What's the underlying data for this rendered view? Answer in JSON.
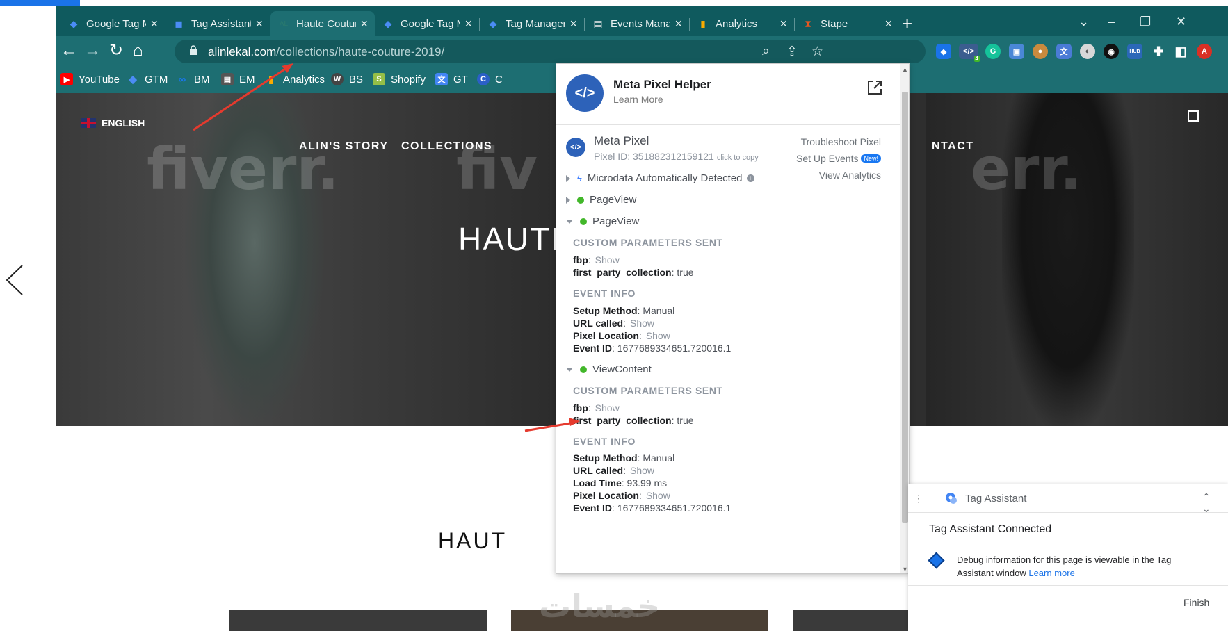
{
  "tabs": [
    {
      "label": "Google Tag M",
      "icon": "diamond-icon",
      "color": "#4b8cf5"
    },
    {
      "label": "Tag Assistant",
      "icon": "tag-icon",
      "color": "#4b8cf5"
    },
    {
      "label": "Haute Coutur",
      "icon": "site-favicon",
      "color": "#2a7a6e",
      "favicon": "AL"
    },
    {
      "label": "Google Tag M",
      "icon": "diamond-icon",
      "color": "#4b8cf5"
    },
    {
      "label": "Tag Manager",
      "icon": "diamond-icon",
      "color": "#4b8cf5"
    },
    {
      "label": "Events Mana",
      "icon": "events-manager-icon",
      "color": "#e8e8e8"
    },
    {
      "label": "Analytics",
      "icon": "analytics-icon",
      "color": "#f9ab00"
    },
    {
      "label": "Stape",
      "icon": "stape-icon",
      "color": "#e8561f"
    }
  ],
  "address": {
    "domain": "alinlekal.com",
    "path": "/collections/haute-couture-2019/"
  },
  "extensions": {
    "pixel_badge": "4",
    "avatar_letter": "A"
  },
  "bookmarks": [
    {
      "label": "YouTube",
      "icon": "youtube-icon",
      "color": "#ff0000",
      "glyph": "▶"
    },
    {
      "label": "GTM",
      "icon": "gtm-icon",
      "color": "#4b8cf5",
      "glyph": "◆"
    },
    {
      "label": "BM",
      "icon": "meta-icon",
      "color": "#1877f2",
      "glyph": "∞"
    },
    {
      "label": "EM",
      "icon": "events-manager-icon",
      "color": "#555555",
      "glyph": "▤"
    },
    {
      "label": "Analytics",
      "icon": "analytics-icon",
      "color": "#f9ab00",
      "glyph": "▮"
    },
    {
      "label": "BS",
      "icon": "wordpress-icon",
      "color": "#444444",
      "glyph": "W"
    },
    {
      "label": "Shopify",
      "icon": "shopify-icon",
      "color": "#95bf47",
      "glyph": "S"
    },
    {
      "label": "GT",
      "icon": "google-translate-icon",
      "color": "#4285f4",
      "glyph": "文"
    },
    {
      "label": "C",
      "icon": "c-icon",
      "color": "#2b5fc7",
      "glyph": "C"
    }
  ],
  "hero": {
    "language": "ENGLISH",
    "nav": [
      "ALIN'S STORY",
      "COLLECTIONS",
      "NTACT"
    ],
    "title": "HAUTE",
    "watermarks": [
      "fiverr.",
      "fiv",
      "err."
    ]
  },
  "page": {
    "heading": "HAUT"
  },
  "pixel_helper": {
    "title": "Meta Pixel Helper",
    "subtitle": "Learn More",
    "pixel_name": "Meta Pixel",
    "pixel_id": "Pixel ID: 351882312159121",
    "copy_hint": "click to copy",
    "troubleshoot": "Troubleshoot Pixel",
    "setup_events": "Set Up Events",
    "new_badge": "New!",
    "view_analytics": "View Analytics",
    "microdata": "Microdata Automatically Detected",
    "events": [
      {
        "name": "PageView",
        "expanded": false
      },
      {
        "name": "PageView",
        "expanded": true,
        "params_header": "CUSTOM PARAMETERS SENT",
        "params": [
          {
            "key": "fbp",
            "value": "Show",
            "muted": true
          },
          {
            "key": "first_party_collection",
            "value": "true",
            "muted": false
          }
        ],
        "info_header": "EVENT INFO",
        "info": [
          {
            "key": "Setup Method",
            "value": "Manual",
            "muted": false
          },
          {
            "key": "URL called",
            "value": "Show",
            "muted": true
          },
          {
            "key": "Pixel Location",
            "value": "Show",
            "muted": true
          },
          {
            "key": "Event ID",
            "value": "1677689334651.720016.1",
            "muted": false
          }
        ]
      },
      {
        "name": "ViewContent",
        "expanded": true,
        "params_header": "CUSTOM PARAMETERS SENT",
        "params": [
          {
            "key": "fbp",
            "value": "Show",
            "muted": true
          },
          {
            "key": "first_party_collection",
            "value": "true",
            "muted": false
          }
        ],
        "info_header": "EVENT INFO",
        "info": [
          {
            "key": "Setup Method",
            "value": "Manual",
            "muted": false
          },
          {
            "key": "URL called",
            "value": "Show",
            "muted": true
          },
          {
            "key": "Load Time",
            "value": "93.99 ms",
            "muted": false
          },
          {
            "key": "Pixel Location",
            "value": "Show",
            "muted": true
          },
          {
            "key": "Event ID",
            "value": "1677689334651.720016.1",
            "muted": false
          }
        ]
      }
    ]
  },
  "tag_assistant": {
    "title": "Tag Assistant",
    "status": "Tag Assistant Connected",
    "message": "Debug information for this page is viewable in the Tag Assistant window",
    "learn_more": "Learn more",
    "finish": "Finish"
  },
  "bottom_watermark": "خمسات",
  "colors": {
    "chrome_dark": "#0f5a5e",
    "chrome": "#1d6e72",
    "annotation_arrow": "#e53a2e",
    "meta_blue": "#2d62b9"
  }
}
